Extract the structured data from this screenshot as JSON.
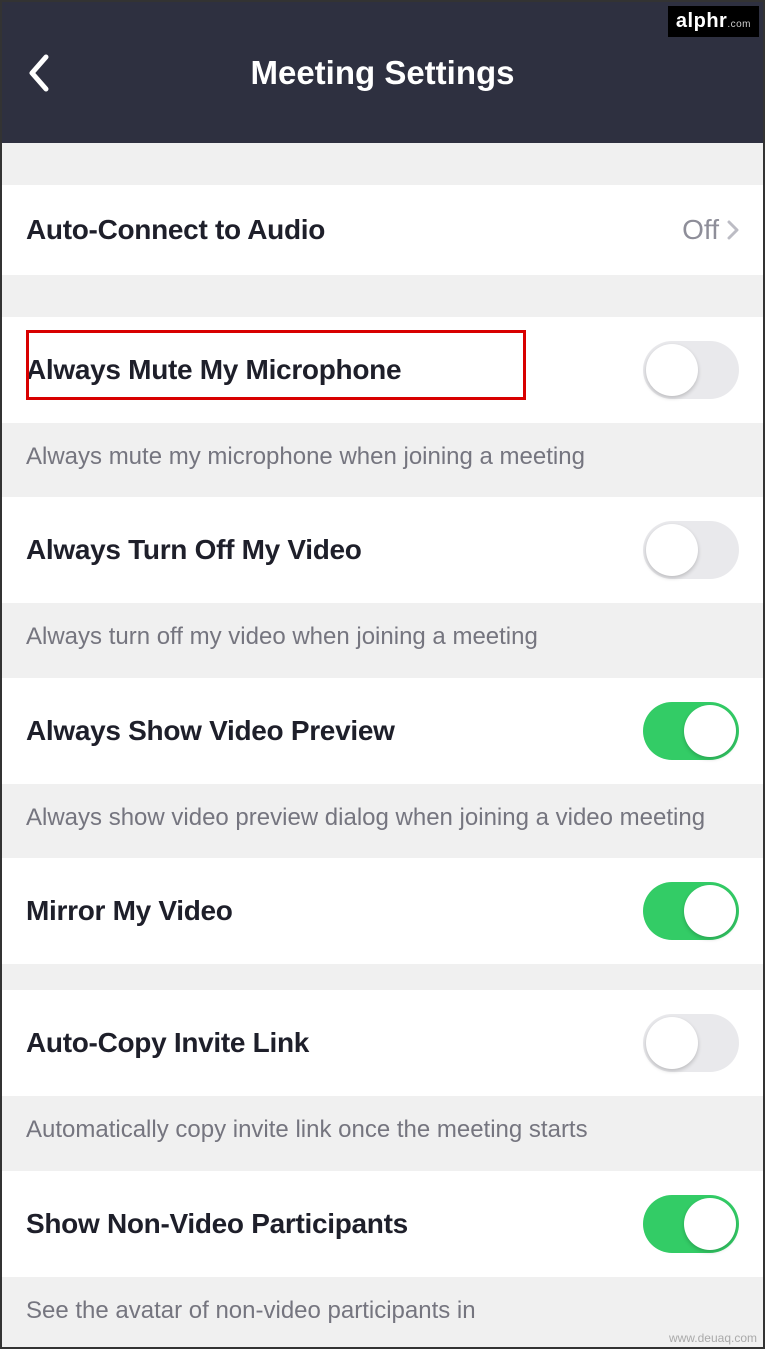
{
  "watermark_top_main": "alphr",
  "watermark_top_suffix": ".com",
  "watermark_bottom": "www.deuaq.com",
  "header": {
    "title": "Meeting Settings"
  },
  "rows": {
    "auto_connect": {
      "label": "Auto-Connect to Audio",
      "value": "Off"
    },
    "mute_mic": {
      "label": "Always Mute My Microphone",
      "desc": "Always mute my microphone when joining a meeting",
      "toggle": "off"
    },
    "turn_off_video": {
      "label": "Always Turn Off My Video",
      "desc": "Always turn off my video when joining a meeting",
      "toggle": "off"
    },
    "video_preview": {
      "label": "Always Show Video Preview",
      "desc": "Always show video preview dialog when joining a video meeting",
      "toggle": "on"
    },
    "mirror": {
      "label": "Mirror My Video",
      "toggle": "on"
    },
    "auto_copy": {
      "label": "Auto-Copy Invite Link",
      "desc": "Automatically copy invite link once the meeting starts",
      "toggle": "off"
    },
    "non_video": {
      "label": "Show Non-Video Participants",
      "desc": "See the avatar of non-video participants in",
      "toggle": "on"
    }
  }
}
